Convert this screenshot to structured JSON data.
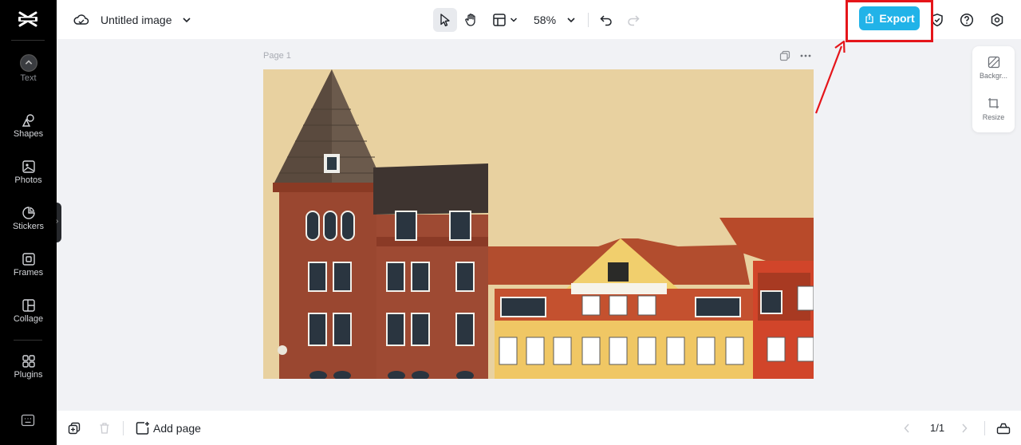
{
  "sidebar": {
    "items": [
      {
        "label": "Text",
        "icon": "text-icon"
      },
      {
        "label": "Shapes",
        "icon": "shapes-icon"
      },
      {
        "label": "Photos",
        "icon": "photos-icon"
      },
      {
        "label": "Stickers",
        "icon": "stickers-icon"
      },
      {
        "label": "Frames",
        "icon": "frames-icon"
      },
      {
        "label": "Collage",
        "icon": "collage-icon"
      },
      {
        "label": "Plugins",
        "icon": "plugins-icon"
      }
    ]
  },
  "header": {
    "title": "Untitled image",
    "zoom": "58%",
    "export_label": "Export"
  },
  "canvas": {
    "page_label": "Page 1",
    "background_color": "#e8d1a0"
  },
  "right_panel": {
    "items": [
      {
        "label": "Backgr...",
        "icon": "background-icon"
      },
      {
        "label": "Resize",
        "icon": "resize-icon"
      }
    ]
  },
  "footer": {
    "add_page_label": "Add page",
    "page_indicator": "1/1"
  },
  "colors": {
    "accent": "#21b3e8",
    "annotation": "#e5151a",
    "rail_background": "#000000"
  }
}
